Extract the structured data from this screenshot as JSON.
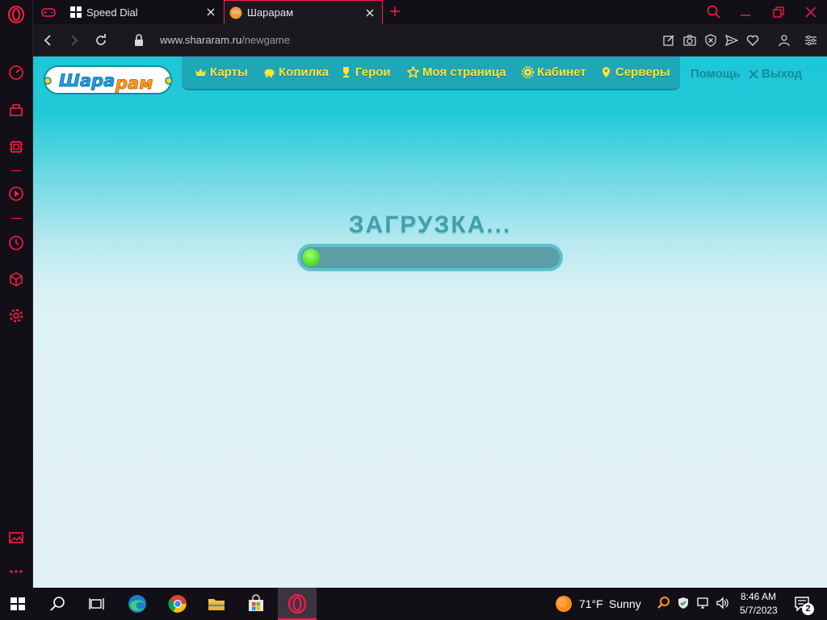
{
  "tabs": [
    {
      "label": "Speed Dial",
      "icon": "speed-dial-icon",
      "active": false
    },
    {
      "label": "Шарарам",
      "icon": "shararam-favicon",
      "active": true
    }
  ],
  "address": {
    "domain": "www.shararam.ru",
    "path": "/newgame"
  },
  "site": {
    "logo_text": "Шара рам",
    "menu": [
      {
        "label": "Карты",
        "icon": "crown-icon"
      },
      {
        "label": "Копилка",
        "icon": "piggy-bank-icon"
      },
      {
        "label": "Герои",
        "icon": "trophy-icon"
      },
      {
        "label": "Моя страница",
        "icon": "star-icon"
      },
      {
        "label": "Кабинет",
        "icon": "gear-icon"
      },
      {
        "label": "Серверы",
        "icon": "map-pin-icon"
      }
    ],
    "help": "Помощь",
    "logout": "Выход",
    "loading_text": "ЗАГРУЗКА...",
    "progress": 0.06
  },
  "taskbar": {
    "weather": {
      "temp": "71°F",
      "condition": "Sunny"
    },
    "time": "8:46 AM",
    "date": "5/7/2023",
    "notifications": "2"
  },
  "colors": {
    "accent": "#ff1b4a",
    "menu_text": "#ffe433",
    "page_top": "#1dc6d7"
  }
}
